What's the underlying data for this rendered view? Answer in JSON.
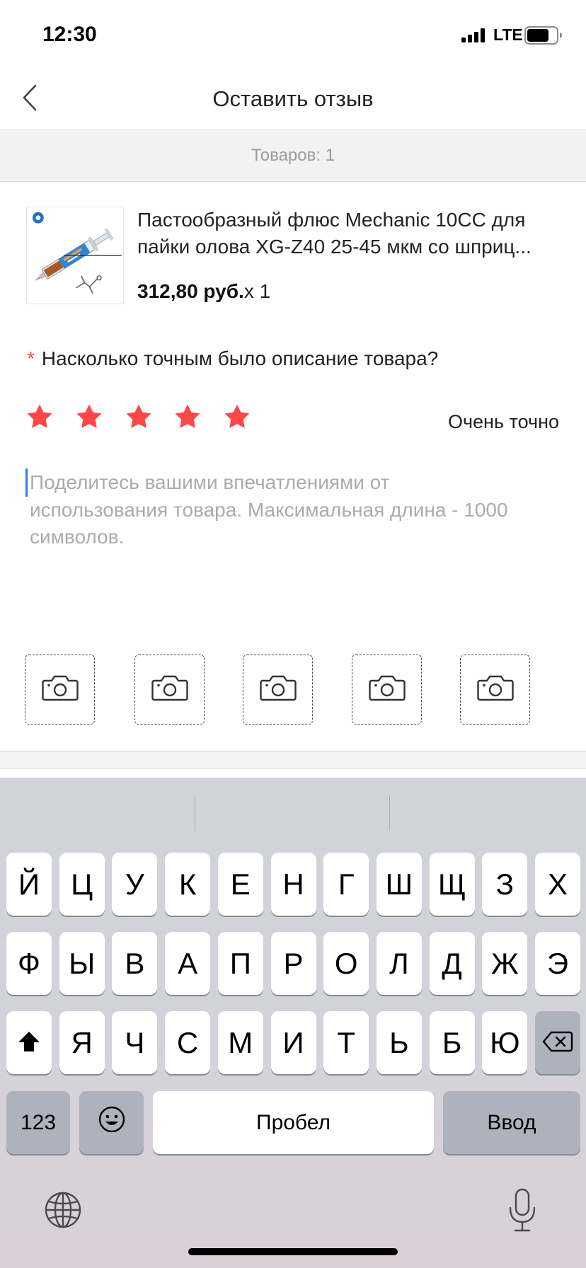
{
  "status_bar": {
    "time": "12:30",
    "network": "LTE",
    "signal_icon": "signal-bars-icon",
    "battery_icon": "battery-icon",
    "battery_level": 0.75
  },
  "nav": {
    "title": "Оставить отзыв",
    "back_icon": "chevron-left-icon"
  },
  "summary": {
    "label": "Товаров: 1"
  },
  "product": {
    "title": "Пастообразный флюс Mechanic 10CC для пайки олова XG-Z40 25-45 мкм со шприц...",
    "price": "312,80 руб.",
    "quantity": "x 1"
  },
  "rating": {
    "required_mark": "*",
    "question": "Насколько точным было описание товара?",
    "value": 5,
    "max": 5,
    "value_label": "Очень точно",
    "star_color": "#ff4747"
  },
  "review": {
    "placeholder_lines": [
      "Поделитесь вашими впечатлениями от",
      "использования товара. Максимальная длина - 1000",
      "символов."
    ],
    "value": ""
  },
  "photos": {
    "slot_count": 5,
    "icon": "camera-icon"
  },
  "keyboard": {
    "row1": [
      "Й",
      "Ц",
      "У",
      "К",
      "Е",
      "Н",
      "Г",
      "Ш",
      "Щ",
      "З",
      "Х"
    ],
    "row2": [
      "Ф",
      "Ы",
      "В",
      "А",
      "П",
      "Р",
      "О",
      "Л",
      "Д",
      "Ж",
      "Э"
    ],
    "row3": [
      "Я",
      "Ч",
      "С",
      "М",
      "И",
      "Т",
      "Ь",
      "Б",
      "Ю"
    ],
    "shift_icon": "shift-icon",
    "delete_icon": "backspace-icon",
    "numbers_label": "123",
    "emoji_icon": "emoji-icon",
    "space_label": "Пробел",
    "return_label": "Ввод",
    "globe_icon": "globe-icon",
    "mic_icon": "microphone-icon",
    "key_color": "#ffffff",
    "function_key_color": "#adb2bc"
  },
  "colors": {
    "accent": "#ff4747",
    "cursor": "#3478f6"
  }
}
